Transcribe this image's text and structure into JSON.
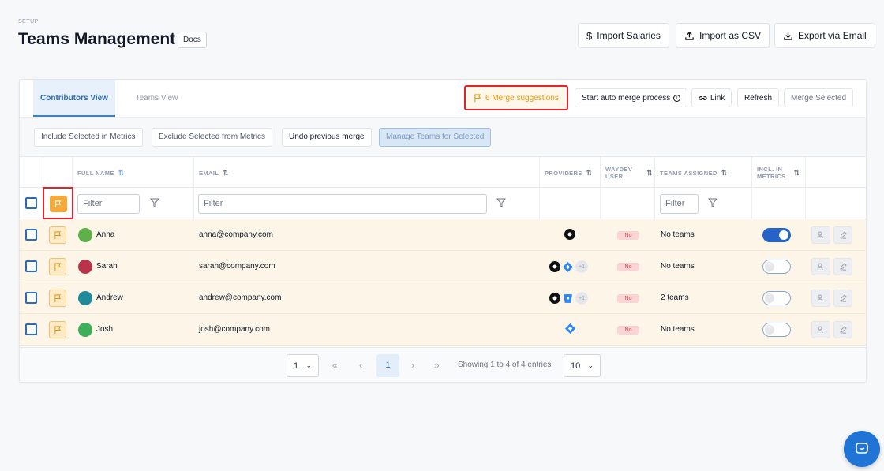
{
  "header": {
    "setup_label": "SETUP",
    "title": "Teams Management",
    "docs_label": "Docs",
    "import_salaries": "Import Salaries",
    "import_csv": "Import as CSV",
    "export_email": "Export via Email"
  },
  "tabs": [
    {
      "label": "Contributors View",
      "active": true
    },
    {
      "label": "Teams View",
      "active": false
    }
  ],
  "toolbar": {
    "merge_suggestions": "6 Merge suggestions",
    "auto_merge": "Start auto merge process",
    "link": "Link",
    "refresh": "Refresh",
    "merge_selected": "Merge Selected"
  },
  "actions": {
    "include": "Include Selected in Metrics",
    "exclude": "Exclude Selected from Metrics",
    "undo": "Undo previous merge",
    "manage": "Manage Teams for Selected"
  },
  "columns": {
    "full_name": "FULL NAME",
    "email": "EMAIL",
    "providers": "PROVIDERS",
    "waydev_user_1": "WAYDEV",
    "waydev_user_2": "USER",
    "teams_assigned": "TEAMS ASSIGNED",
    "incl_1": "INCL. IN",
    "incl_2": "METRICS"
  },
  "filters": {
    "name_placeholder": "Filter",
    "email_placeholder": "Filter",
    "teams_placeholder": "Filter"
  },
  "rows": [
    {
      "name": "Anna",
      "email": "anna@company.com",
      "providers": [
        "github-icon"
      ],
      "waydev": "No",
      "teams": "No teams",
      "included": true
    },
    {
      "name": "Sarah",
      "email": "sarah@company.com",
      "providers": [
        "github-icon",
        "jira-icon"
      ],
      "extra": "+1",
      "waydev": "No",
      "teams": "No teams",
      "included": false
    },
    {
      "name": "Andrew",
      "email": "andrew@company.com",
      "providers": [
        "github-icon",
        "bitbucket-icon"
      ],
      "extra": "+1",
      "waydev": "No",
      "teams": "2 teams",
      "included": false
    },
    {
      "name": "Josh",
      "email": "josh@company.com",
      "providers": [
        "jira-icon"
      ],
      "waydev": "No",
      "teams": "No teams",
      "included": false
    }
  ],
  "pagination": {
    "page_select": "1",
    "current_page": "1",
    "info": "Showing 1 to 4 of 4 entries",
    "per_page": "10"
  },
  "colors": {
    "accent": "#2d6cb5",
    "merge_text": "#e59a12",
    "highlight_border": "#e0242b",
    "row_bg": "#fdf6e8"
  }
}
